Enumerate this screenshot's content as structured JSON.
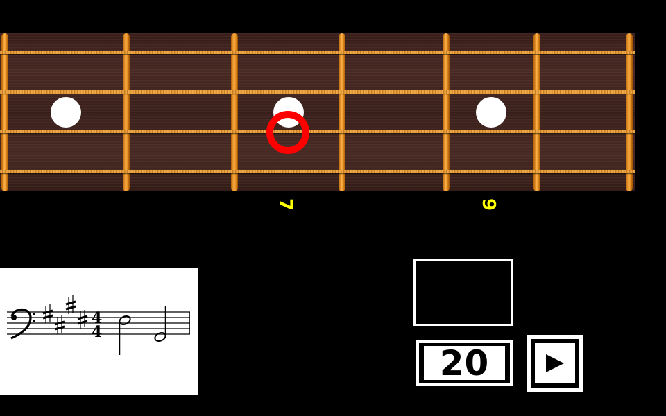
{
  "fretboard": {
    "fret_labels": [
      "7",
      "9"
    ],
    "colors": {
      "fret": "#f39a2b",
      "marker": "#ff0000",
      "label": "#ffff00",
      "inlay": "#ffffff"
    },
    "marker_icon": "target-ring-icon"
  },
  "staff": {
    "clef": "bass",
    "key_signature": "sharps",
    "time_signature": "4/4"
  },
  "controls": {
    "tempo_value": "20",
    "play_icon": "play-icon"
  }
}
